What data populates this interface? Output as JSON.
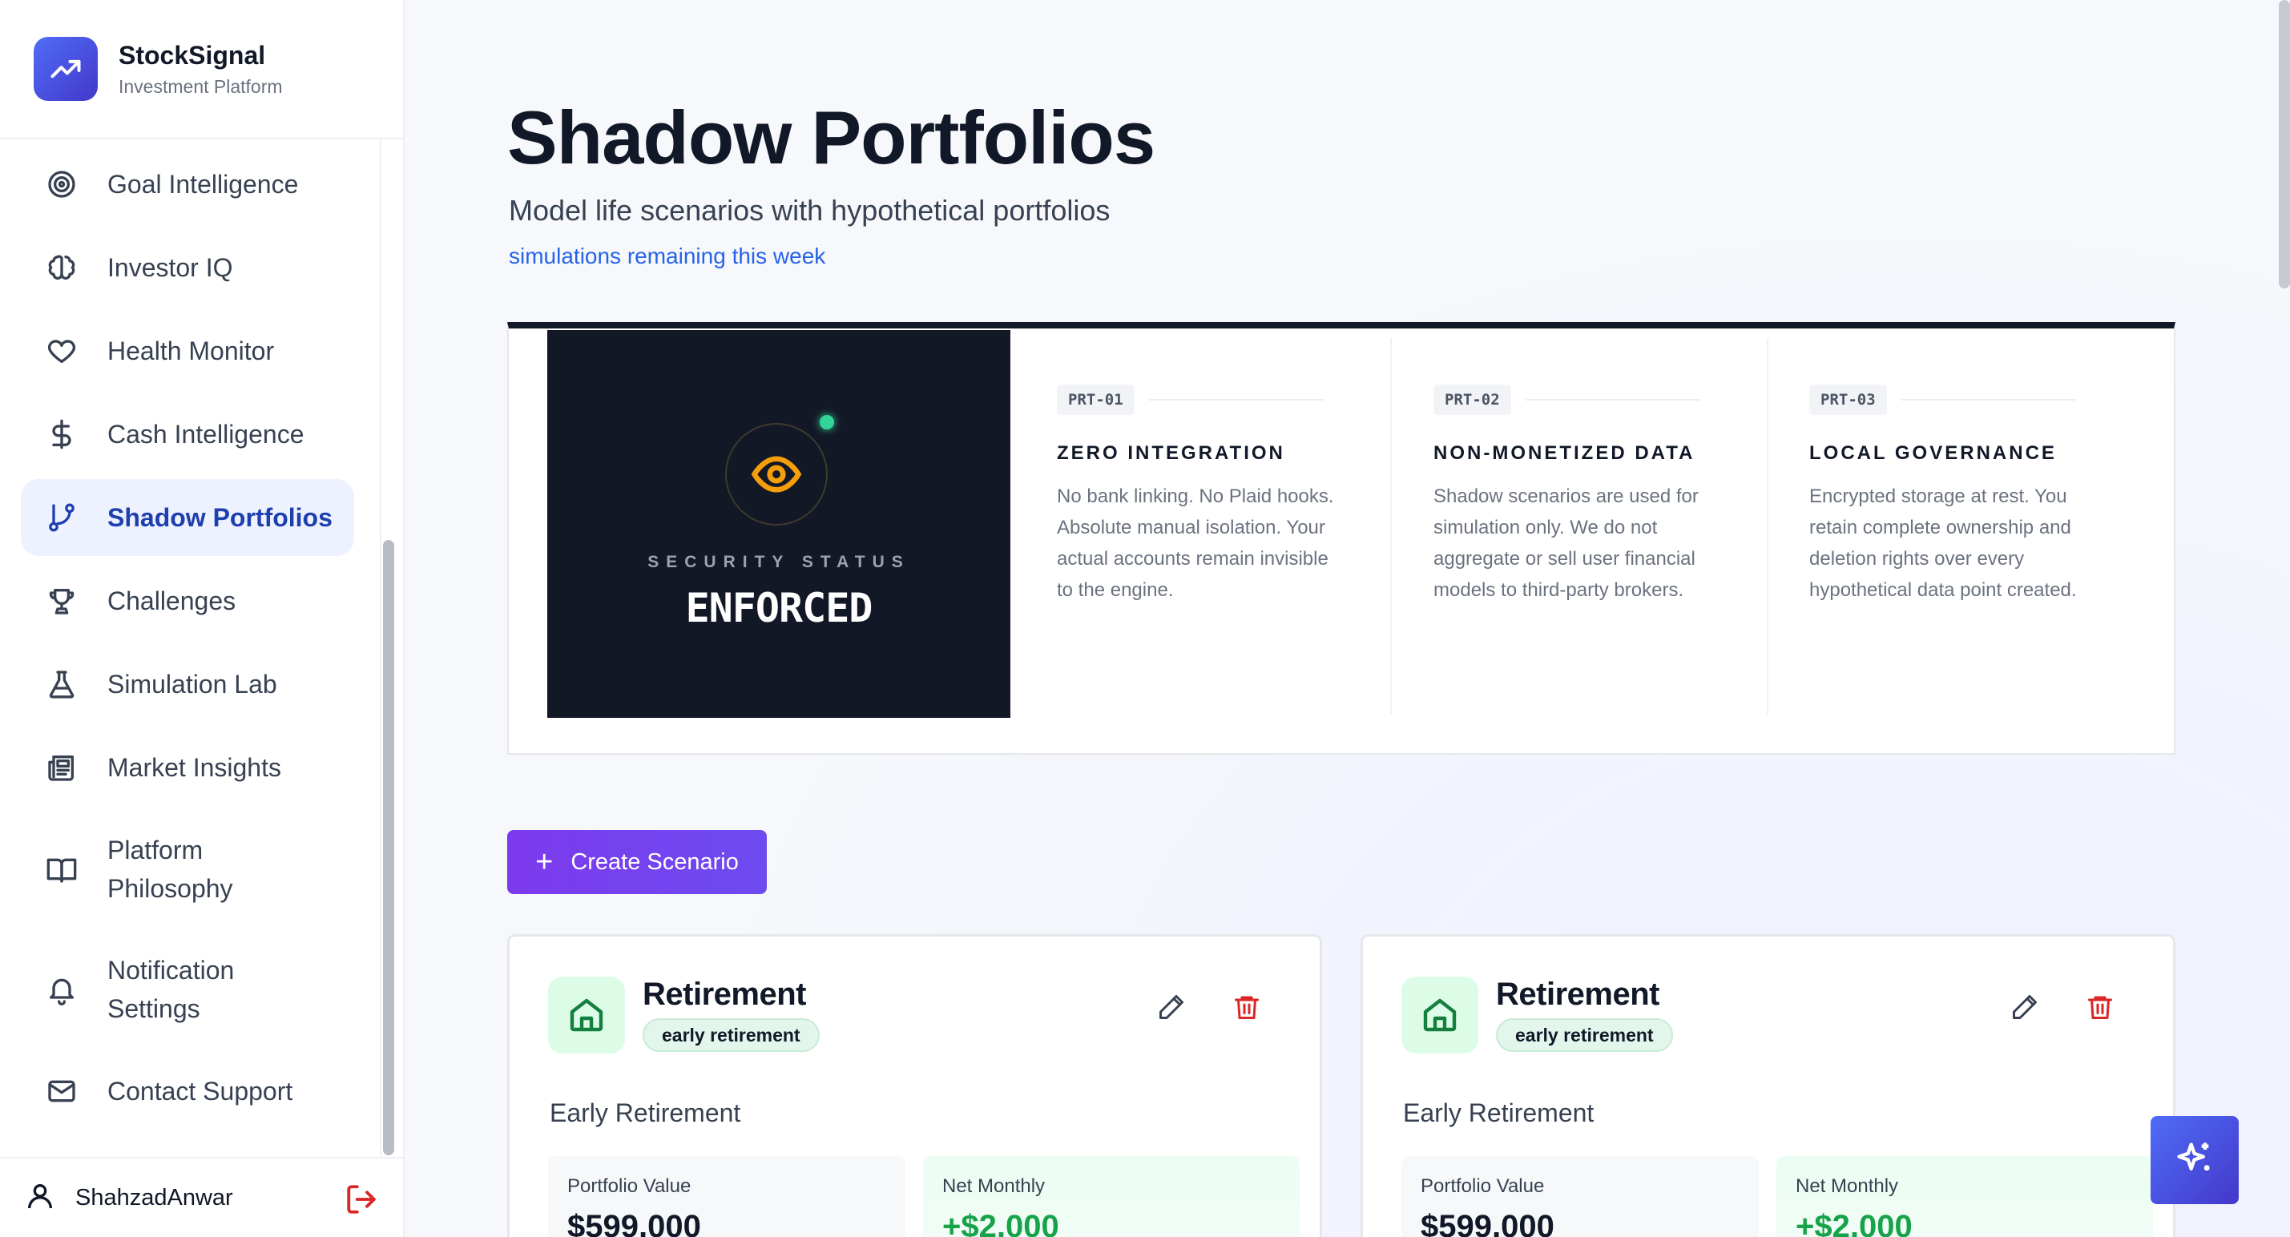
{
  "brand": {
    "name": "StockSignal",
    "subtitle": "Investment Platform"
  },
  "sidebar": {
    "items": [
      {
        "label": "Goal Intelligence",
        "icon": "target-icon"
      },
      {
        "label": "Investor IQ",
        "icon": "brain-icon"
      },
      {
        "label": "Health Monitor",
        "icon": "heart-icon"
      },
      {
        "label": "Cash Intelligence",
        "icon": "dollar-icon"
      },
      {
        "label": "Shadow Portfolios",
        "icon": "git-branch-icon",
        "active": true
      },
      {
        "label": "Challenges",
        "icon": "trophy-icon"
      },
      {
        "label": "Simulation Lab",
        "icon": "flask-icon"
      },
      {
        "label": "Market Insights",
        "icon": "newspaper-icon"
      },
      {
        "label": "Platform Philosophy",
        "icon": "book-icon"
      },
      {
        "label": "Notification Settings",
        "icon": "bell-icon"
      },
      {
        "label": "Contact Support",
        "icon": "mail-icon"
      }
    ],
    "user": {
      "name": "ShahzadAnwar"
    }
  },
  "page": {
    "title": "Shadow Portfolios",
    "subtitle": "Model life scenarios with hypothetical portfolios",
    "simulations_link": "simulations remaining this week"
  },
  "security": {
    "status_label": "SECURITY STATUS",
    "status_value": "ENFORCED",
    "principles": [
      {
        "code": "PRT-01",
        "title": "ZERO INTEGRATION",
        "text": "No bank linking. No Plaid hooks. Absolute manual isolation. Your actual accounts remain invisible to the engine."
      },
      {
        "code": "PRT-02",
        "title": "NON-MONETIZED DATA",
        "text": "Shadow scenarios are used for simulation only. We do not aggregate or sell user financial models to third-party brokers."
      },
      {
        "code": "PRT-03",
        "title": "LOCAL GOVERNANCE",
        "text": "Encrypted storage at rest. You retain complete ownership and deletion rights over every hypothetical data point created."
      }
    ]
  },
  "actions": {
    "create_scenario": "Create Scenario"
  },
  "scenarios": [
    {
      "title": "Retirement",
      "badge": "early retirement",
      "description": "Early Retirement",
      "portfolio_label": "Portfolio Value",
      "portfolio_value": "$599,000",
      "net_label": "Net Monthly",
      "net_value": "+$2,000"
    },
    {
      "title": "Retirement",
      "badge": "early retirement",
      "description": "Early Retirement",
      "portfolio_label": "Portfolio Value",
      "portfolio_value": "$599,000",
      "net_label": "Net Monthly",
      "net_value": "+$2,000"
    }
  ],
  "colors": {
    "accent": "#4f6cf7",
    "active_nav": "#1e40af",
    "create_button": "#7c3aed",
    "positive": "#16a34a",
    "danger": "#dc2626"
  }
}
